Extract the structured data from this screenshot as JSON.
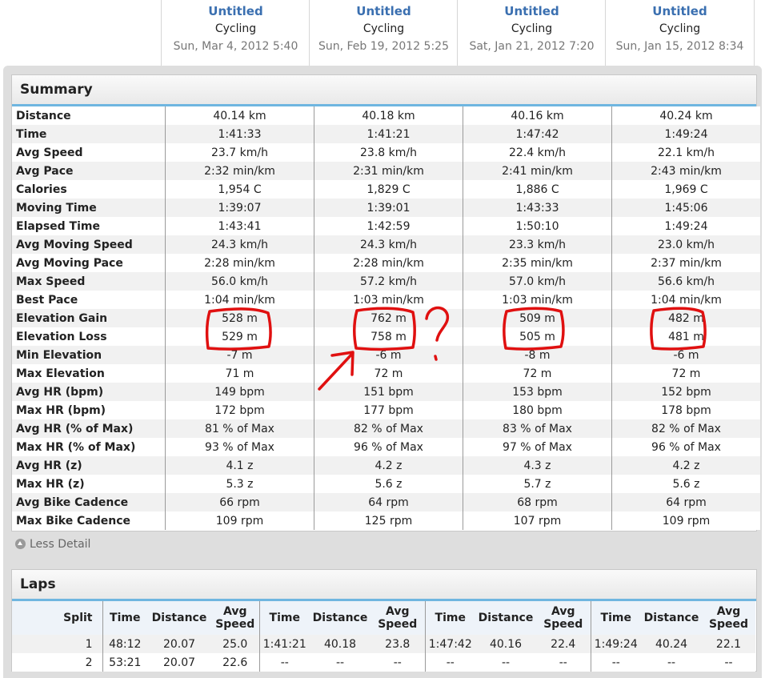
{
  "activities": [
    {
      "title": "Untitled",
      "sport": "Cycling",
      "date": "Sun, Mar 4, 2012 5:40"
    },
    {
      "title": "Untitled",
      "sport": "Cycling",
      "date": "Sun, Feb 19, 2012 5:25"
    },
    {
      "title": "Untitled",
      "sport": "Cycling",
      "date": "Sat, Jan 21, 2012 7:20"
    },
    {
      "title": "Untitled",
      "sport": "Cycling",
      "date": "Sun, Jan 15, 2012 8:34"
    }
  ],
  "summary": {
    "title": "Summary",
    "rows": [
      {
        "label": "Distance",
        "values": [
          "40.14 km",
          "40.18 km",
          "40.16 km",
          "40.24 km"
        ]
      },
      {
        "label": "Time",
        "values": [
          "1:41:33",
          "1:41:21",
          "1:47:42",
          "1:49:24"
        ]
      },
      {
        "label": "Avg Speed",
        "values": [
          "23.7 km/h",
          "23.8 km/h",
          "22.4 km/h",
          "22.1 km/h"
        ]
      },
      {
        "label": "Avg Pace",
        "values": [
          "2:32 min/km",
          "2:31 min/km",
          "2:41 min/km",
          "2:43 min/km"
        ]
      },
      {
        "label": "Calories",
        "values": [
          "1,954 C",
          "1,829 C",
          "1,886 C",
          "1,969 C"
        ]
      },
      {
        "label": "Moving Time",
        "values": [
          "1:39:07",
          "1:39:01",
          "1:43:33",
          "1:45:06"
        ]
      },
      {
        "label": "Elapsed Time",
        "values": [
          "1:43:41",
          "1:42:59",
          "1:50:10",
          "1:49:24"
        ]
      },
      {
        "label": "Avg Moving Speed",
        "values": [
          "24.3 km/h",
          "24.3 km/h",
          "23.3 km/h",
          "23.0 km/h"
        ]
      },
      {
        "label": "Avg Moving Pace",
        "values": [
          "2:28 min/km",
          "2:28 min/km",
          "2:35 min/km",
          "2:37 min/km"
        ]
      },
      {
        "label": "Max Speed",
        "values": [
          "56.0 km/h",
          "57.2 km/h",
          "57.0 km/h",
          "56.6 km/h"
        ]
      },
      {
        "label": "Best Pace",
        "values": [
          "1:04 min/km",
          "1:03 min/km",
          "1:03 min/km",
          "1:04 min/km"
        ]
      },
      {
        "label": "Elevation Gain",
        "values": [
          "528 m",
          "762 m",
          "509 m",
          "482 m"
        ]
      },
      {
        "label": "Elevation Loss",
        "values": [
          "529 m",
          "758 m",
          "505 m",
          "481 m"
        ]
      },
      {
        "label": "Min Elevation",
        "values": [
          "-7 m",
          "-6 m",
          "-8 m",
          "-6 m"
        ]
      },
      {
        "label": "Max Elevation",
        "values": [
          "71 m",
          "72 m",
          "72 m",
          "72 m"
        ]
      },
      {
        "label": "Avg HR (bpm)",
        "values": [
          "149 bpm",
          "151 bpm",
          "153 bpm",
          "152 bpm"
        ]
      },
      {
        "label": "Max HR (bpm)",
        "values": [
          "172 bpm",
          "177 bpm",
          "180 bpm",
          "178 bpm"
        ]
      },
      {
        "label": "Avg HR (% of Max)",
        "values": [
          "81 % of Max",
          "82 % of Max",
          "83 % of Max",
          "82 % of Max"
        ]
      },
      {
        "label": "Max HR (% of Max)",
        "values": [
          "93 % of Max",
          "96 % of Max",
          "97 % of Max",
          "96 % of Max"
        ]
      },
      {
        "label": "Avg HR (z)",
        "values": [
          "4.1 z",
          "4.2 z",
          "4.3 z",
          "4.2 z"
        ]
      },
      {
        "label": "Max HR (z)",
        "values": [
          "5.3 z",
          "5.6 z",
          "5.7 z",
          "5.6 z"
        ]
      },
      {
        "label": "Avg Bike Cadence",
        "values": [
          "66 rpm",
          "64 rpm",
          "68 rpm",
          "64 rpm"
        ]
      },
      {
        "label": "Max Bike Cadence",
        "values": [
          "109 rpm",
          "125 rpm",
          "107 rpm",
          "109 rpm"
        ]
      }
    ]
  },
  "less_detail_label": "Less Detail",
  "laps": {
    "title": "Laps",
    "split_header": "Split",
    "group_headers": [
      "Time",
      "Distance",
      "Avg Speed"
    ],
    "rows": [
      {
        "split": "1",
        "groups": [
          [
            "48:12",
            "20.07",
            "25.0"
          ],
          [
            "1:41:21",
            "40.18",
            "23.8"
          ],
          [
            "1:47:42",
            "40.16",
            "22.4"
          ],
          [
            "1:49:24",
            "40.24",
            "22.1"
          ]
        ]
      },
      {
        "split": "2",
        "groups": [
          [
            "53:21",
            "20.07",
            "22.6"
          ],
          [
            "--",
            "--",
            "--"
          ],
          [
            "--",
            "--",
            "--"
          ],
          [
            "--",
            "--",
            "--"
          ]
        ]
      }
    ]
  },
  "annotation": {
    "question_mark": "?",
    "color": "#e01010"
  },
  "colors": {
    "link": "#3a6fb0",
    "accent": "#6fb6e0",
    "frame": "#dedede"
  }
}
